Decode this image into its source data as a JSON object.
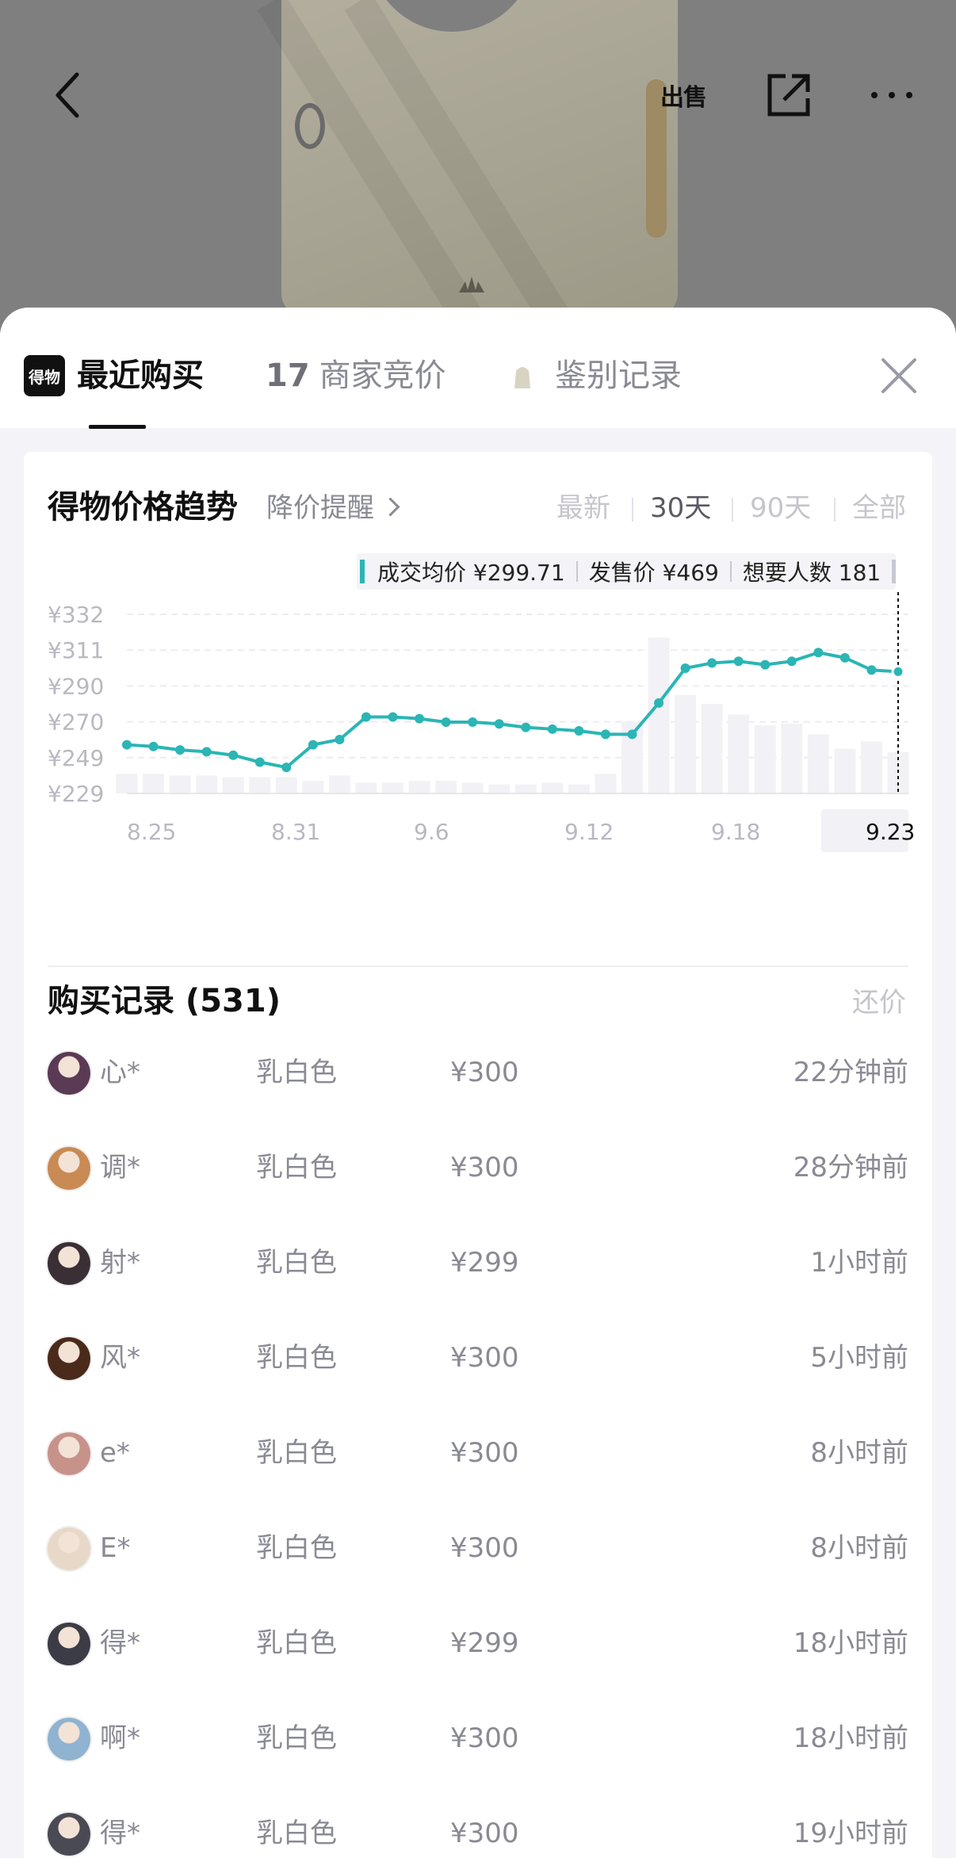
{
  "header": {
    "back_icon": "chevron-left-icon",
    "sell_label": "出售",
    "share_icon": "share-icon",
    "more_icon": "more-icon"
  },
  "tabs": {
    "logo_text": "得物",
    "items": [
      {
        "label": "最近购买",
        "active": true
      },
      {
        "count": "17",
        "label": "商家竞价",
        "active": false
      },
      {
        "label": "鉴别记录",
        "active": false
      }
    ],
    "close_icon": "close-icon"
  },
  "trend": {
    "title": "得物价格趋势",
    "alert_label": "降价提醒",
    "ranges": [
      "最新",
      "30天",
      "90天",
      "全部"
    ],
    "selected_range": "30天",
    "legend": {
      "avg_label": "成交均价 ¥299.71",
      "release_label": "发售价 ¥469",
      "want_label": "想要人数 181"
    }
  },
  "chart_data": {
    "type": "line",
    "title": "得物价格趋势",
    "y_ticks": [
      "¥332",
      "¥311",
      "¥290",
      "¥270",
      "¥249",
      "¥229"
    ],
    "x_ticks": [
      "8.25",
      "8.31",
      "9.6",
      "9.12",
      "9.18",
      "9.23"
    ],
    "highlighted_x": "9.23",
    "ylim": [
      229,
      332
    ],
    "grid": true,
    "accent_color": "#2bb5b5",
    "series": [
      {
        "values": [
          257,
          256,
          254,
          253,
          251,
          247,
          244,
          257,
          260,
          273,
          273,
          272,
          270,
          270,
          269,
          267,
          266,
          265,
          263,
          263,
          281,
          301,
          304,
          305,
          303,
          305,
          310,
          307,
          300,
          299
        ]
      }
    ],
    "volume_bars": [
      11,
      11,
      10,
      10,
      9,
      9,
      9,
      7,
      10,
      6,
      6,
      7,
      7,
      6,
      5,
      5,
      6,
      5,
      11,
      40,
      87,
      55,
      50,
      44,
      38,
      39,
      33,
      25,
      29,
      23
    ]
  },
  "records": {
    "title": "购买记录 (531)",
    "action_label": "还价",
    "items": [
      {
        "nick": "心*",
        "color": "乳白色",
        "price": "¥300",
        "time": "22分钟前",
        "avatar_color": "#5b3a55"
      },
      {
        "nick": "调*",
        "color": "乳白色",
        "price": "¥300",
        "time": "28分钟前",
        "avatar_color": "#c98a54"
      },
      {
        "nick": "射*",
        "color": "乳白色",
        "price": "¥299",
        "time": "1小时前",
        "avatar_color": "#3a2f35"
      },
      {
        "nick": "风*",
        "color": "乳白色",
        "price": "¥300",
        "time": "5小时前",
        "avatar_color": "#4a2a1a"
      },
      {
        "nick": "e*",
        "color": "乳白色",
        "price": "¥300",
        "time": "8小时前",
        "avatar_color": "#c7928a"
      },
      {
        "nick": "E*",
        "color": "乳白色",
        "price": "¥300",
        "time": "8小时前",
        "avatar_color": "#e8d8c8"
      },
      {
        "nick": "得*",
        "color": "乳白色",
        "price": "¥299",
        "time": "18小时前",
        "avatar_color": "#3c3c46"
      },
      {
        "nick": "啊*",
        "color": "乳白色",
        "price": "¥300",
        "time": "18小时前",
        "avatar_color": "#8fb3d0"
      },
      {
        "nick": "得*",
        "color": "乳白色",
        "price": "¥300",
        "time": "19小时前",
        "avatar_color": "#4a4a55"
      }
    ]
  }
}
